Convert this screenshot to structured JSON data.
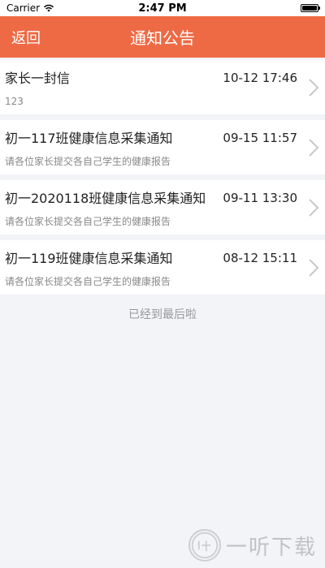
{
  "status_bar": {
    "carrier": "Carrier",
    "time": "2:47 PM"
  },
  "nav": {
    "back_label": "返回",
    "title": "通知公告"
  },
  "notices": [
    {
      "title": "家长一封信",
      "time": "10-12 17:46",
      "subtitle": "123"
    },
    {
      "title": "初一117班健康信息采集通知",
      "time": "09-15 11:57",
      "subtitle": "请各位家长提交各自己学生的健康报告"
    },
    {
      "title": "初一2020118班健康信息采集通知",
      "time": "09-11 13:30",
      "subtitle": "请各位家长提交各自己学生的健康报告"
    },
    {
      "title": "初一119班健康信息采集通知",
      "time": "08-12 15:11",
      "subtitle": "请各位家长提交各自己学生的健康报告"
    }
  ],
  "footer_note": "已经到最后啦",
  "watermark": {
    "text": "一听下载"
  },
  "colors": {
    "accent": "#ee6a44",
    "background": "#f3f4f8"
  }
}
